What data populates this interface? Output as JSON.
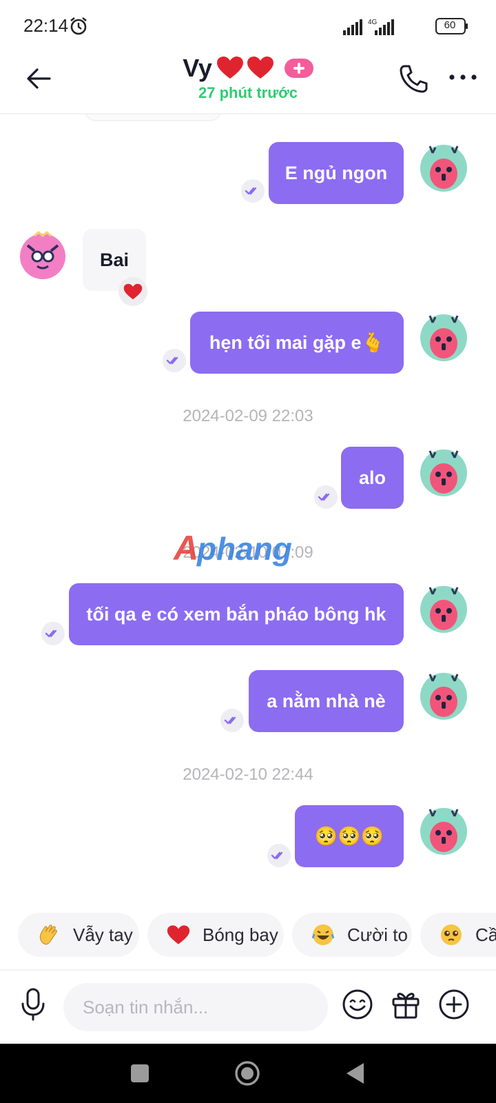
{
  "status_bar": {
    "time": "22:14",
    "network": "4G",
    "battery": "60"
  },
  "header": {
    "contact_name": "Vy",
    "last_seen": "27 phút trước"
  },
  "messages": [
    {
      "direction": "out",
      "text": "E ngủ ngon",
      "status": "seen"
    },
    {
      "direction": "in",
      "text": "Bai",
      "reaction": "heart"
    },
    {
      "direction": "out",
      "text": "hẹn tối mai gặp e🫰",
      "status": "seen"
    },
    {
      "type": "timestamp",
      "text": "2024-02-09 22:03"
    },
    {
      "direction": "out",
      "text": "alo",
      "status": "seen"
    },
    {
      "type": "timestamp",
      "text": "2024-02-10 07:09"
    },
    {
      "direction": "out",
      "text": "tối qa e có xem bắn pháo bông hk",
      "status": "seen"
    },
    {
      "direction": "out",
      "text": "a nằm nhà nè",
      "status": "seen"
    },
    {
      "type": "timestamp",
      "text": "2024-02-10 22:44"
    },
    {
      "direction": "out",
      "text": "🥺🥺🥺",
      "status": "seen"
    }
  ],
  "watermark": "Aphang",
  "quick_reactions": [
    {
      "label": "Vẫy tay",
      "icon": "waving-hand-icon"
    },
    {
      "label": "Bóng bay",
      "icon": "heart-icon"
    },
    {
      "label": "Cười to",
      "icon": "laughing-face-icon"
    },
    {
      "label": "Cầ",
      "icon": "pleading-face-icon"
    }
  ],
  "composer": {
    "placeholder": "Soạn tin nhắn..."
  },
  "colors": {
    "accent": "#8c6cf1",
    "online_green": "#2ecc71",
    "badge_pink": "#f25d9c"
  }
}
